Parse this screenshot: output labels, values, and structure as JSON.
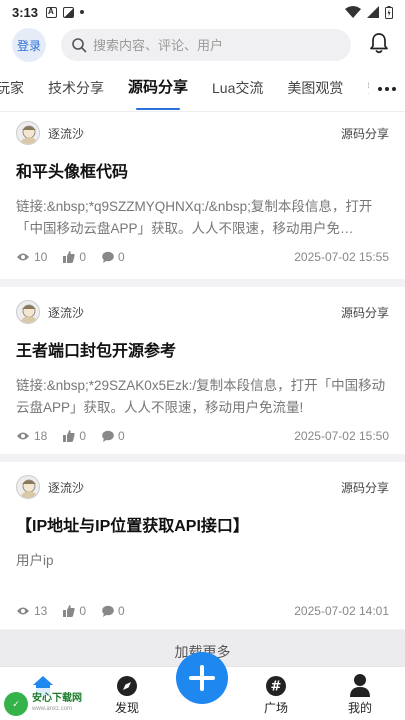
{
  "status": {
    "time": "3:13"
  },
  "header": {
    "login_label": "登录",
    "search_placeholder": "搜索内容、评论、用户"
  },
  "tabs": [
    {
      "label": "玩家"
    },
    {
      "label": "技术分享"
    },
    {
      "label": "源码分享",
      "active": true
    },
    {
      "label": "Lua交流"
    },
    {
      "label": "美图观赏"
    },
    {
      "label": "安"
    }
  ],
  "posts": [
    {
      "author": "逐流沙",
      "category": "源码分享",
      "title": "和平头像框代码",
      "excerpt": "链接:&nbsp;*q9SZZMYQHNXq:/&nbsp;复制本段信息，打开「中国移动云盘APP」获取。人人不限速，移动用户免…",
      "views": "10",
      "likes": "0",
      "comments": "0",
      "date": "2025-07-02 15:55"
    },
    {
      "author": "逐流沙",
      "category": "源码分享",
      "title": "王者端口封包开源参考",
      "excerpt": "链接:&nbsp;*29SZAK0x5Ezk:/复制本段信息，打开「中国移动云盘APP」获取。人人不限速，移动用户免流量!",
      "views": "18",
      "likes": "0",
      "comments": "0",
      "date": "2025-07-02 15:50"
    },
    {
      "author": "逐流沙",
      "category": "源码分享",
      "title": "【IP地址与IP位置获取API接口】",
      "excerpt": "用户ip",
      "views": "13",
      "likes": "0",
      "comments": "0",
      "date": "2025-07-02 14:01"
    }
  ],
  "load_more": "加载更多",
  "nav": {
    "discover": "发现",
    "square": "广场",
    "mine": "我的"
  },
  "watermark": {
    "name": "安心下载网",
    "url": "www.anxz.com"
  },
  "colors": {
    "accent": "#1e88f0",
    "tab_underline": "#2b6fd8"
  }
}
